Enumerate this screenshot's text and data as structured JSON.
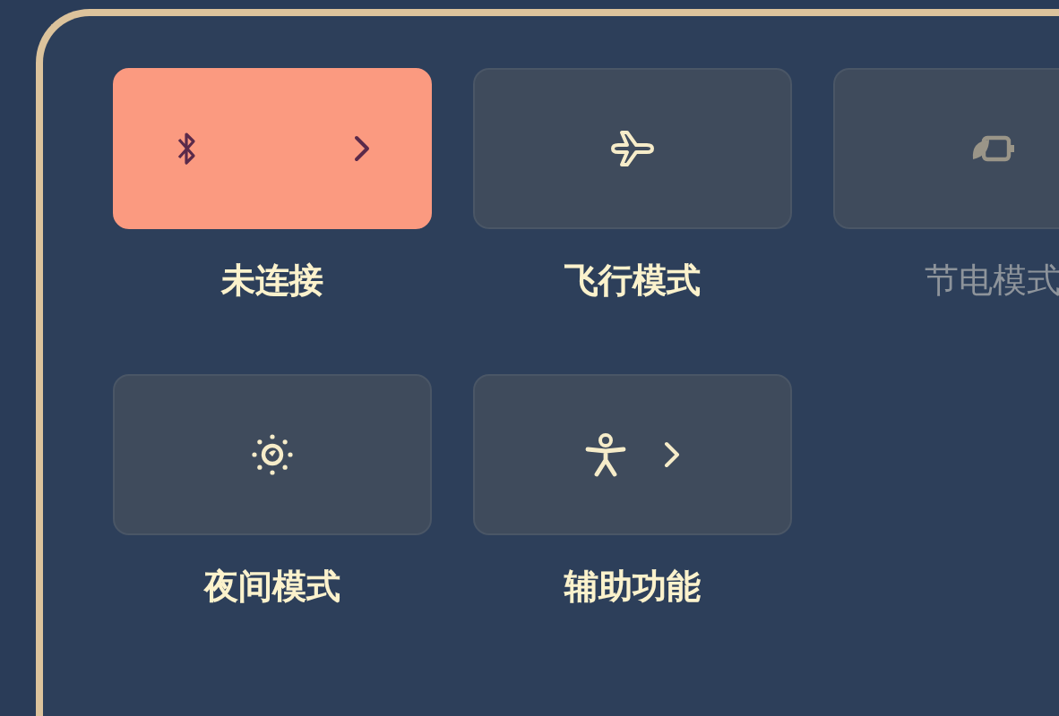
{
  "tiles": [
    {
      "kind": "bluetooth",
      "label": "未连接",
      "on": true,
      "disabled": false,
      "submenu": true
    },
    {
      "kind": "airplane",
      "label": "飞行模式",
      "on": false,
      "disabled": false,
      "submenu": false
    },
    {
      "kind": "battery-saver",
      "label": "节电模式",
      "on": false,
      "disabled": true,
      "submenu": false
    },
    {
      "kind": "night",
      "label": "夜间模式",
      "on": false,
      "disabled": false,
      "submenu": false
    },
    {
      "kind": "accessibility",
      "label": "辅助功能",
      "on": false,
      "disabled": false,
      "submenu": true
    }
  ]
}
